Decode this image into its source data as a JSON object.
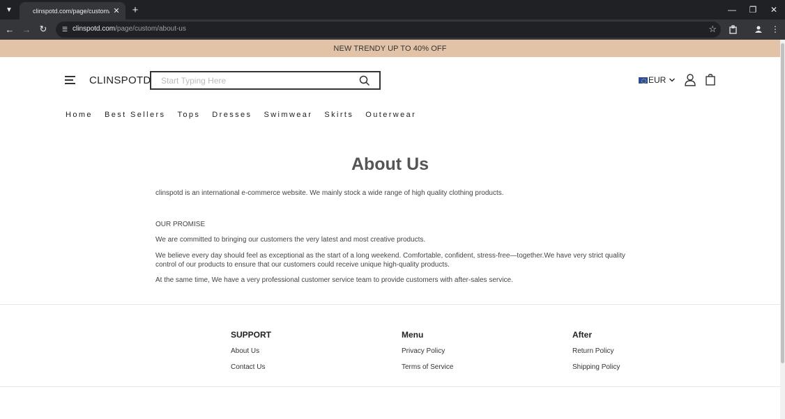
{
  "browser": {
    "tab_title": "clinspotd.com/page/custom/about-us",
    "url_host": "clinspotd.com",
    "url_path": "/page/custom/about-us"
  },
  "promo": {
    "text": "NEW TRENDY UP TO 40% OFF"
  },
  "header": {
    "logo": "CLINSPOTD",
    "search_placeholder": "Start Typing Here",
    "currency": "EUR"
  },
  "nav": [
    "Home",
    "Best Sellers",
    "Tops",
    "Dresses",
    "Swimwear",
    "Skirts",
    "Outerwear"
  ],
  "content": {
    "title": "About Us",
    "intro": "clinspotd is an international e-commerce website. We mainly stock a wide range of high quality clothing products.",
    "promise_heading": "OUR PROMISE",
    "p1": "We are committed to bringing our customers the very latest and most creative products.",
    "p2": "We believe every day should feel as exceptional as the start of a long weekend. Comfortable, confident, stress-free—together.We have very strict quality control of our products to ensure that our customers could receive unique high-quality products.",
    "p3": "At the same time, We have a very professional customer service team to provide customers with after-sales service."
  },
  "footer": {
    "support": {
      "heading": "SUPPORT",
      "links": [
        "About Us",
        "Contact Us"
      ]
    },
    "menu": {
      "heading": "Menu",
      "links": [
        "Privacy Policy",
        "Terms of Service"
      ]
    },
    "after": {
      "heading": "After",
      "links": [
        "Return Policy",
        "Shipping Policy"
      ]
    }
  },
  "colors": {
    "promo_bg": "#e2c3a8",
    "chrome_dark": "#202124",
    "chrome_mid": "#35363a"
  }
}
